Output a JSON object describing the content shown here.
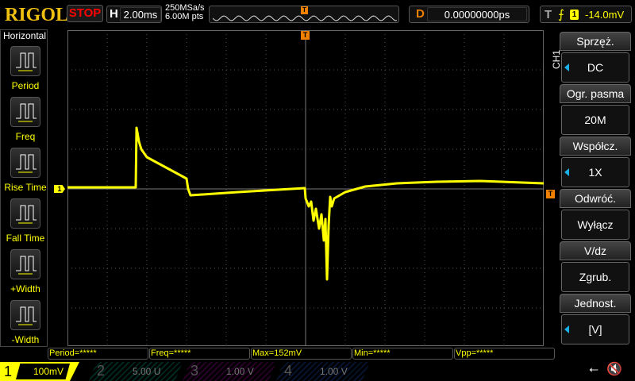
{
  "header": {
    "logo": "RIGOL",
    "run_state": "STOP",
    "h_label": "H",
    "timebase": "2.00ms",
    "sample_rate": "250MSa/s",
    "mem_depth": "6.00M pts",
    "d_label": "D",
    "delay": "0.00000000ps",
    "t_label": "T",
    "trigger_source": "1",
    "trigger_level": "-14.0mV"
  },
  "left_menu": {
    "title": "Horizontal",
    "items": [
      {
        "label": "Period",
        "icon": "period-icon"
      },
      {
        "label": "Freq",
        "icon": "frequency-icon"
      },
      {
        "label": "Rise Time",
        "icon": "rise-time-icon"
      },
      {
        "label": "Fall Time",
        "icon": "fall-time-icon"
      },
      {
        "label": "+Width",
        "icon": "positive-width-icon"
      },
      {
        "label": "-Width",
        "icon": "negative-width-icon"
      }
    ]
  },
  "right_menu": {
    "channel": "CH1",
    "items": [
      {
        "title": "Sprzęż.",
        "value": "DC"
      },
      {
        "title": "Ogr. pasma",
        "value": "20M"
      },
      {
        "title": "Współcz.",
        "value": "1X"
      },
      {
        "title": "Odwróć.",
        "value": "Wyłącz"
      },
      {
        "title": "V/dz",
        "value": "Zgrub."
      },
      {
        "title": "Jednost.",
        "value": "[V]"
      }
    ]
  },
  "markers": {
    "ch1": "1",
    "trigger": "T"
  },
  "measurements": [
    "Period=*****",
    "Freq=*****",
    "Max=152mV",
    "Min=*****",
    "Vpp=*****"
  ],
  "channels": [
    {
      "num": "1",
      "scale": "100mV",
      "color": "#ffff00"
    },
    {
      "num": "2",
      "scale": "5.00 U",
      "color": "#00c0a0"
    },
    {
      "num": "3",
      "scale": "1.00 V",
      "color": "#c000c0"
    },
    {
      "num": "4",
      "scale": "1.00 V",
      "color": "#2060e0"
    }
  ],
  "colors": {
    "ch1": "#ffff00",
    "trigger": "#f08000",
    "accent": "#1ab0e8"
  }
}
